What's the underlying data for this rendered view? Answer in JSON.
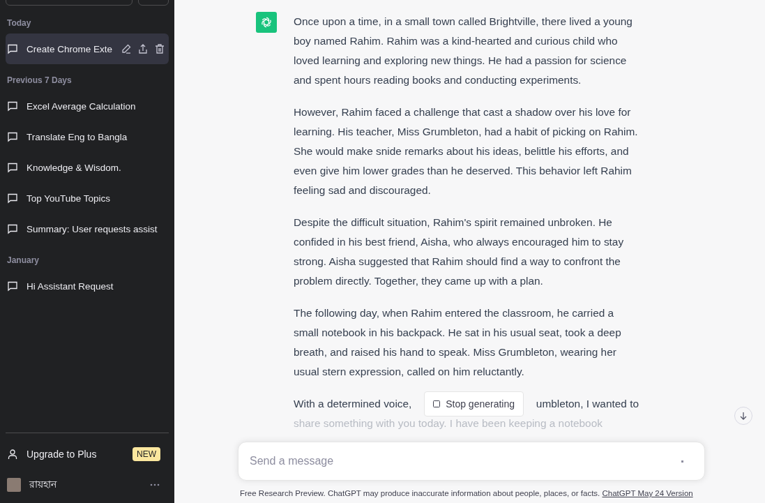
{
  "sidebar": {
    "sections": [
      {
        "heading": "Today",
        "items": [
          {
            "title": "Create Chrome Exte",
            "selected": true
          }
        ]
      },
      {
        "heading": "Previous 7 Days",
        "items": [
          {
            "title": "Excel Average Calculation",
            "selected": false
          },
          {
            "title": "Translate Eng to Bangla",
            "selected": false
          },
          {
            "title": "Knowledge & Wisdom.",
            "selected": false
          },
          {
            "title": "Top YouTube Topics",
            "selected": false
          },
          {
            "title": "Summary: User requests assist",
            "selected": false
          }
        ]
      },
      {
        "heading": "January",
        "items": [
          {
            "title": "Hi Assistant Request",
            "selected": false
          }
        ]
      }
    ],
    "upgrade": {
      "label": "Upgrade to Plus",
      "badge": "NEW"
    },
    "user": {
      "name": "রায়হান"
    }
  },
  "conversation": {
    "paragraphs": [
      "Once upon a time, in a small town called Brightville, there lived a young boy named Rahim. Rahim was a kind-hearted and curious child who loved learning and exploring new things. He had a passion for science and spent hours reading books and conducting experiments.",
      "However, Rahim faced a challenge that cast a shadow over his love for learning. His teacher, Miss Grumbleton, had a habit of picking on Rahim. She would make snide remarks about his ideas, belittle his efforts, and even give him lower grades than he deserved. This behavior left Rahim feeling sad and discouraged.",
      "Despite the difficult situation, Rahim's spirit remained unbroken. He confided in his best friend, Aisha, who always encouraged him to stay strong. Aisha suggested that Rahim should find a way to confront the problem directly. Together, they came up with a plan.",
      "The following day, when Rahim entered the classroom, he carried a small notebook in his backpack. He sat in his usual seat, took a deep breath, and raised his hand to speak. Miss Grumbleton, wearing her usual stern expression, called on him reluctantly."
    ],
    "partial_paragraph": {
      "line_start": "With a determined voice,",
      "line_end": "umbleton, I wanted to",
      "faded_line": "share something with you today. I have been keeping a notebook"
    }
  },
  "stop_button": {
    "label": "Stop generating"
  },
  "composer": {
    "placeholder": "Send a message"
  },
  "footer": {
    "text": "Free Research Preview. ChatGPT may produce inaccurate information about people, places, or facts.",
    "link": "ChatGPT May 24 Version"
  }
}
